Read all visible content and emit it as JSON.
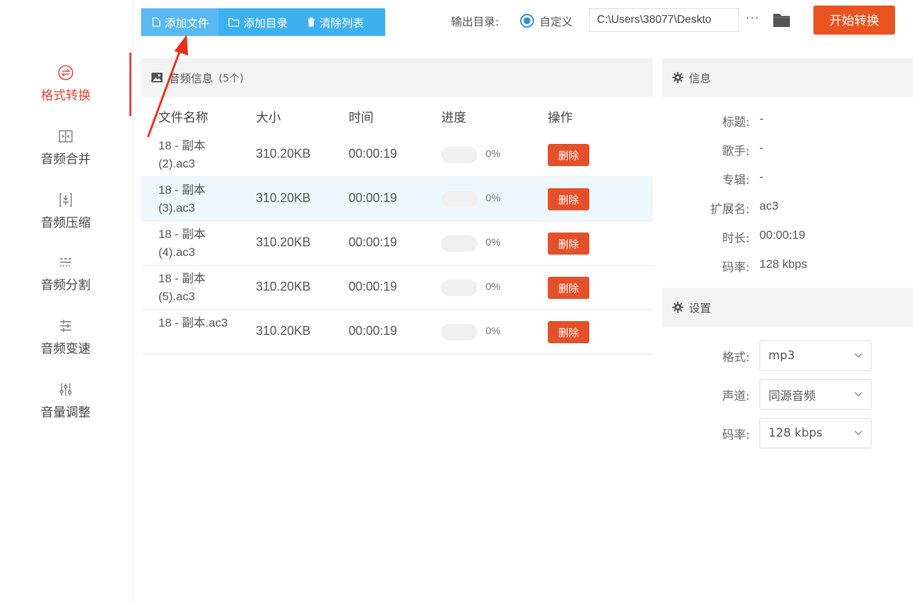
{
  "sidebar": {
    "items": [
      {
        "label": "格式转换",
        "icon": "convert-icon",
        "active": true
      },
      {
        "label": "音频合并",
        "icon": "merge-icon"
      },
      {
        "label": "音频压缩",
        "icon": "compress-icon"
      },
      {
        "label": "音频分割",
        "icon": "split-icon"
      },
      {
        "label": "音频变速",
        "icon": "speed-icon"
      },
      {
        "label": "音量调整",
        "icon": "volume-icon"
      }
    ]
  },
  "toolbar": {
    "add_file": "添加文件",
    "add_dir": "添加目录",
    "clear_list": "清除列表",
    "output_label": "输出目录:",
    "custom_label": "自定义",
    "path_value": "C:\\Users\\38077\\Deskto",
    "more": "···",
    "start": "开始转换"
  },
  "file_panel": {
    "title": "音频信息",
    "count": "(5个)",
    "columns": [
      "文件名称",
      "大小",
      "时间",
      "进度",
      "操作"
    ],
    "rows": [
      {
        "name": "18 - 副本 (2).ac3",
        "size": "310.20KB",
        "time": "00:00:19",
        "progress": 0,
        "pct": "0%",
        "action": "删除"
      },
      {
        "name": "18 - 副本 (3).ac3",
        "size": "310.20KB",
        "time": "00:00:19",
        "progress": 0,
        "pct": "0%",
        "action": "删除"
      },
      {
        "name": "18 - 副本 (4).ac3",
        "size": "310.20KB",
        "time": "00:00:19",
        "progress": 0,
        "pct": "0%",
        "action": "删除"
      },
      {
        "name": "18 - 副本 (5).ac3",
        "size": "310.20KB",
        "time": "00:00:19",
        "progress": 0,
        "pct": "0%",
        "action": "删除"
      },
      {
        "name": "18 - 副本.ac3",
        "size": "310.20KB",
        "time": "00:00:19",
        "progress": 0,
        "pct": "0%",
        "action": "删除"
      }
    ]
  },
  "info_panel": {
    "title": "信息",
    "fields": [
      {
        "key": "标题:",
        "value": "-"
      },
      {
        "key": "歌手:",
        "value": "-"
      },
      {
        "key": "专辑:",
        "value": "-"
      },
      {
        "key": "扩展名:",
        "value": "ac3"
      },
      {
        "key": "时长:",
        "value": "00:00:19"
      },
      {
        "key": "码率:",
        "value": "128 kbps"
      }
    ]
  },
  "settings_panel": {
    "title": "设置",
    "fields": [
      {
        "key": "格式:",
        "value": "mp3"
      },
      {
        "key": "声道:",
        "value": "同源音频"
      },
      {
        "key": "码率:",
        "value": "128 kbps"
      }
    ]
  },
  "colors": {
    "accent_red": "#e0483a",
    "toolbar_blue": "#3eb0f0",
    "start_orange": "#e8531f",
    "delete_red": "#e3502a"
  }
}
